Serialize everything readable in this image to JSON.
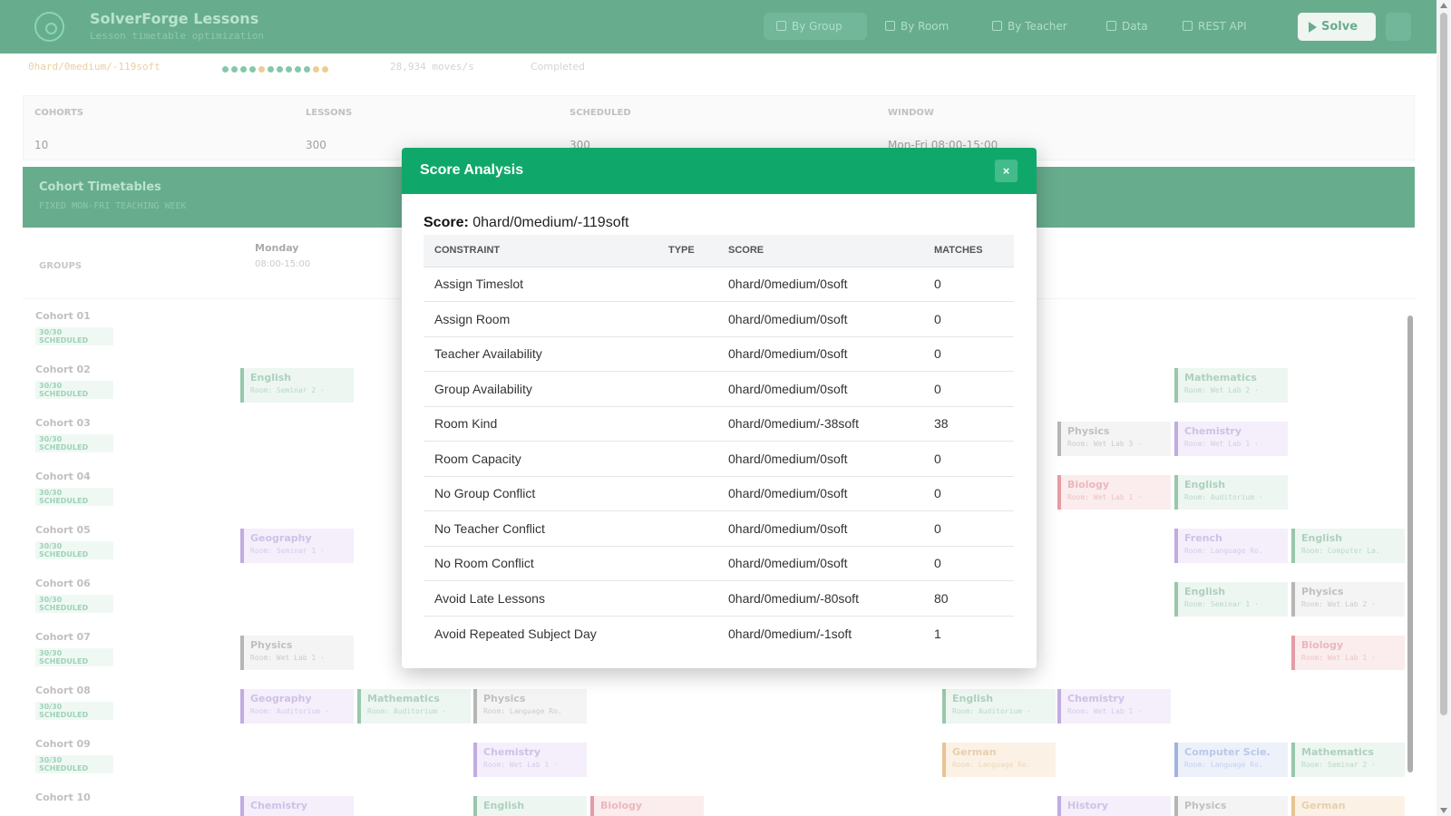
{
  "header": {
    "app_title": "SolverForge Lessons",
    "app_subtitle": "Lesson timetable optimization",
    "nav": [
      {
        "label": "By Group",
        "icon": "users-icon",
        "active": true
      },
      {
        "label": "By Room",
        "icon": "door-icon",
        "active": false
      },
      {
        "label": "By Teacher",
        "icon": "chat-icon",
        "active": false
      },
      {
        "label": "Data",
        "icon": "table-icon",
        "active": false
      },
      {
        "label": "REST API",
        "icon": "api-icon",
        "active": false
      }
    ],
    "solve_label": "Solve",
    "menu_label": "≡"
  },
  "status": {
    "score": "0hard/0medium/-119soft",
    "speed": "28,934 moves/s",
    "state": "Completed"
  },
  "summary": {
    "headers": [
      "COHORTS",
      "LESSONS",
      "SCHEDULED",
      "WINDOW"
    ],
    "values": [
      "10",
      "300",
      "300",
      "Mon-Fri 08:00-15:00"
    ]
  },
  "timetable": {
    "title": "Cohort Timetables",
    "subtitle": "FIXED MON-FRI TEACHING WEEK",
    "groups_header": "GROUPS",
    "day": "Monday",
    "day_hours": "08:00-15:00",
    "cohorts": [
      {
        "name": "Cohort 01",
        "badge": "30/30 SCHEDULED"
      },
      {
        "name": "Cohort 02",
        "badge": "30/30 SCHEDULED"
      },
      {
        "name": "Cohort 03",
        "badge": "30/30 SCHEDULED"
      },
      {
        "name": "Cohort 04",
        "badge": "30/30 SCHEDULED"
      },
      {
        "name": "Cohort 05",
        "badge": "30/30 SCHEDULED"
      },
      {
        "name": "Cohort 06",
        "badge": "30/30 SCHEDULED"
      },
      {
        "name": "Cohort 07",
        "badge": "30/30 SCHEDULED"
      },
      {
        "name": "Cohort 08",
        "badge": "30/30 SCHEDULED"
      },
      {
        "name": "Cohort 09",
        "badge": "30/30 SCHEDULED"
      },
      {
        "name": "Cohort 10",
        "badge": ""
      }
    ],
    "lessons": [
      {
        "subject": "English",
        "room": "Room: Seminar 2 ·",
        "color": "green"
      },
      {
        "subject": "Mathematics",
        "room": "Room: Wet Lab 2 ·",
        "color": "green"
      },
      {
        "subject": "Physics",
        "room": "Room: Wet Lab 3 ·",
        "color": "gray"
      },
      {
        "subject": "Chemistry",
        "room": "Room: Wet Lab 1 ·",
        "color": "purple"
      },
      {
        "subject": "Biology",
        "room": "Room: Wet Lab 1 ·",
        "color": "red"
      },
      {
        "subject": "English",
        "room": "Room: Auditorium ·",
        "color": "green"
      },
      {
        "subject": "Geography",
        "room": "Room: Seminar 1 ·",
        "color": "purple"
      },
      {
        "subject": "French",
        "room": "Room: Language Ro.",
        "color": "purple"
      },
      {
        "subject": "English",
        "room": "Room: Computer La.",
        "color": "green"
      },
      {
        "subject": "English",
        "room": "Room: Seminar 1 ·",
        "color": "green"
      },
      {
        "subject": "Physics",
        "room": "Room: Wet Lab 2 ·",
        "color": "gray"
      },
      {
        "subject": "Physics",
        "room": "Room: Wet Lab 1 ·",
        "color": "gray"
      },
      {
        "subject": "Biology",
        "room": "Room: Wet Lab 1 ·",
        "color": "red"
      },
      {
        "subject": "Geography",
        "room": "Room: Auditorium ·",
        "color": "purple"
      },
      {
        "subject": "Mathematics",
        "room": "Room: Auditorium ·",
        "color": "green"
      },
      {
        "subject": "Physics",
        "room": "Room: Language Ro.",
        "color": "gray"
      },
      {
        "subject": "English",
        "room": "Room: Auditorium ·",
        "color": "green"
      },
      {
        "subject": "Chemistry",
        "room": "Room: Wet Lab 1 ·",
        "color": "purple"
      },
      {
        "subject": "Chemistry",
        "room": "Room: Wet Lab 1 ·",
        "color": "purple"
      },
      {
        "subject": "German",
        "room": "Room: Language Ro.",
        "color": "orange"
      },
      {
        "subject": "Computer Scie.",
        "room": "Room: Language Ro.",
        "color": "blue"
      },
      {
        "subject": "Mathematics",
        "room": "Room: Seminar 2 ·",
        "color": "green"
      },
      {
        "subject": "Chemistry",
        "room": "",
        "color": "purple"
      },
      {
        "subject": "English",
        "room": "",
        "color": "green"
      },
      {
        "subject": "Biology",
        "room": "",
        "color": "red"
      },
      {
        "subject": "History",
        "room": "",
        "color": "purple"
      },
      {
        "subject": "Physics",
        "room": "",
        "color": "gray"
      },
      {
        "subject": "German",
        "room": "",
        "color": "orange"
      }
    ]
  },
  "modal": {
    "title": "Score Analysis",
    "close_label": "×",
    "score_label": "Score:",
    "score_value": "0hard/0medium/-119soft",
    "columns": [
      "CONSTRAINT",
      "TYPE",
      "SCORE",
      "MATCHES"
    ],
    "rows": [
      {
        "constraint": "Assign Timeslot",
        "type": "",
        "score": "0hard/0medium/0soft",
        "matches": "0"
      },
      {
        "constraint": "Assign Room",
        "type": "",
        "score": "0hard/0medium/0soft",
        "matches": "0"
      },
      {
        "constraint": "Teacher Availability",
        "type": "",
        "score": "0hard/0medium/0soft",
        "matches": "0"
      },
      {
        "constraint": "Group Availability",
        "type": "",
        "score": "0hard/0medium/0soft",
        "matches": "0"
      },
      {
        "constraint": "Room Kind",
        "type": "",
        "score": "0hard/0medium/-38soft",
        "matches": "38"
      },
      {
        "constraint": "Room Capacity",
        "type": "",
        "score": "0hard/0medium/0soft",
        "matches": "0"
      },
      {
        "constraint": "No Group Conflict",
        "type": "",
        "score": "0hard/0medium/0soft",
        "matches": "0"
      },
      {
        "constraint": "No Teacher Conflict",
        "type": "",
        "score": "0hard/0medium/0soft",
        "matches": "0"
      },
      {
        "constraint": "No Room Conflict",
        "type": "",
        "score": "0hard/0medium/0soft",
        "matches": "0"
      },
      {
        "constraint": "Avoid Late Lessons",
        "type": "",
        "score": "0hard/0medium/-80soft",
        "matches": "80"
      },
      {
        "constraint": "Avoid Repeated Subject Day",
        "type": "",
        "score": "0hard/0medium/-1soft",
        "matches": "1"
      }
    ]
  },
  "colors": {
    "header_bg": "#0c7a4a",
    "modal_header_bg": "#10a86a"
  }
}
